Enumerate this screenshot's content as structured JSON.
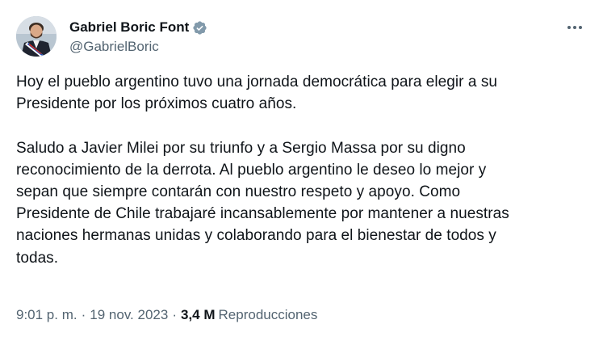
{
  "author": {
    "display_name": "Gabriel Boric Font",
    "handle": "@GabrielBoric",
    "verified": true,
    "verified_color": "#829aab",
    "avatar_icon": "profile-photo"
  },
  "more_icon": "ellipsis-icon",
  "tweet": {
    "text": "Hoy el pueblo argentino tuvo una jornada democrática para elegir a su\nPresidente por los próximos cuatro años.\n\nSaludo a Javier Milei por su triunfo y a Sergio Massa por su digno\nreconocimiento de la derrota. Al pueblo argentino le deseo lo mejor y\nsepan que siempre contarán con nuestro respeto y apoyo. Como\nPresidente de Chile trabajaré incansablemente por mantener a nuestras\nnaciones hermanas unidas y colaborando para el bienestar de todos y\ntodas."
  },
  "meta": {
    "time": "9:01 p. m.",
    "separator": "·",
    "date": "19 nov. 2023",
    "views_count": "3,4 M",
    "views_label": "Reproducciones"
  },
  "colors": {
    "text_primary": "#0f1419",
    "text_secondary": "#536471",
    "background": "#ffffff"
  }
}
